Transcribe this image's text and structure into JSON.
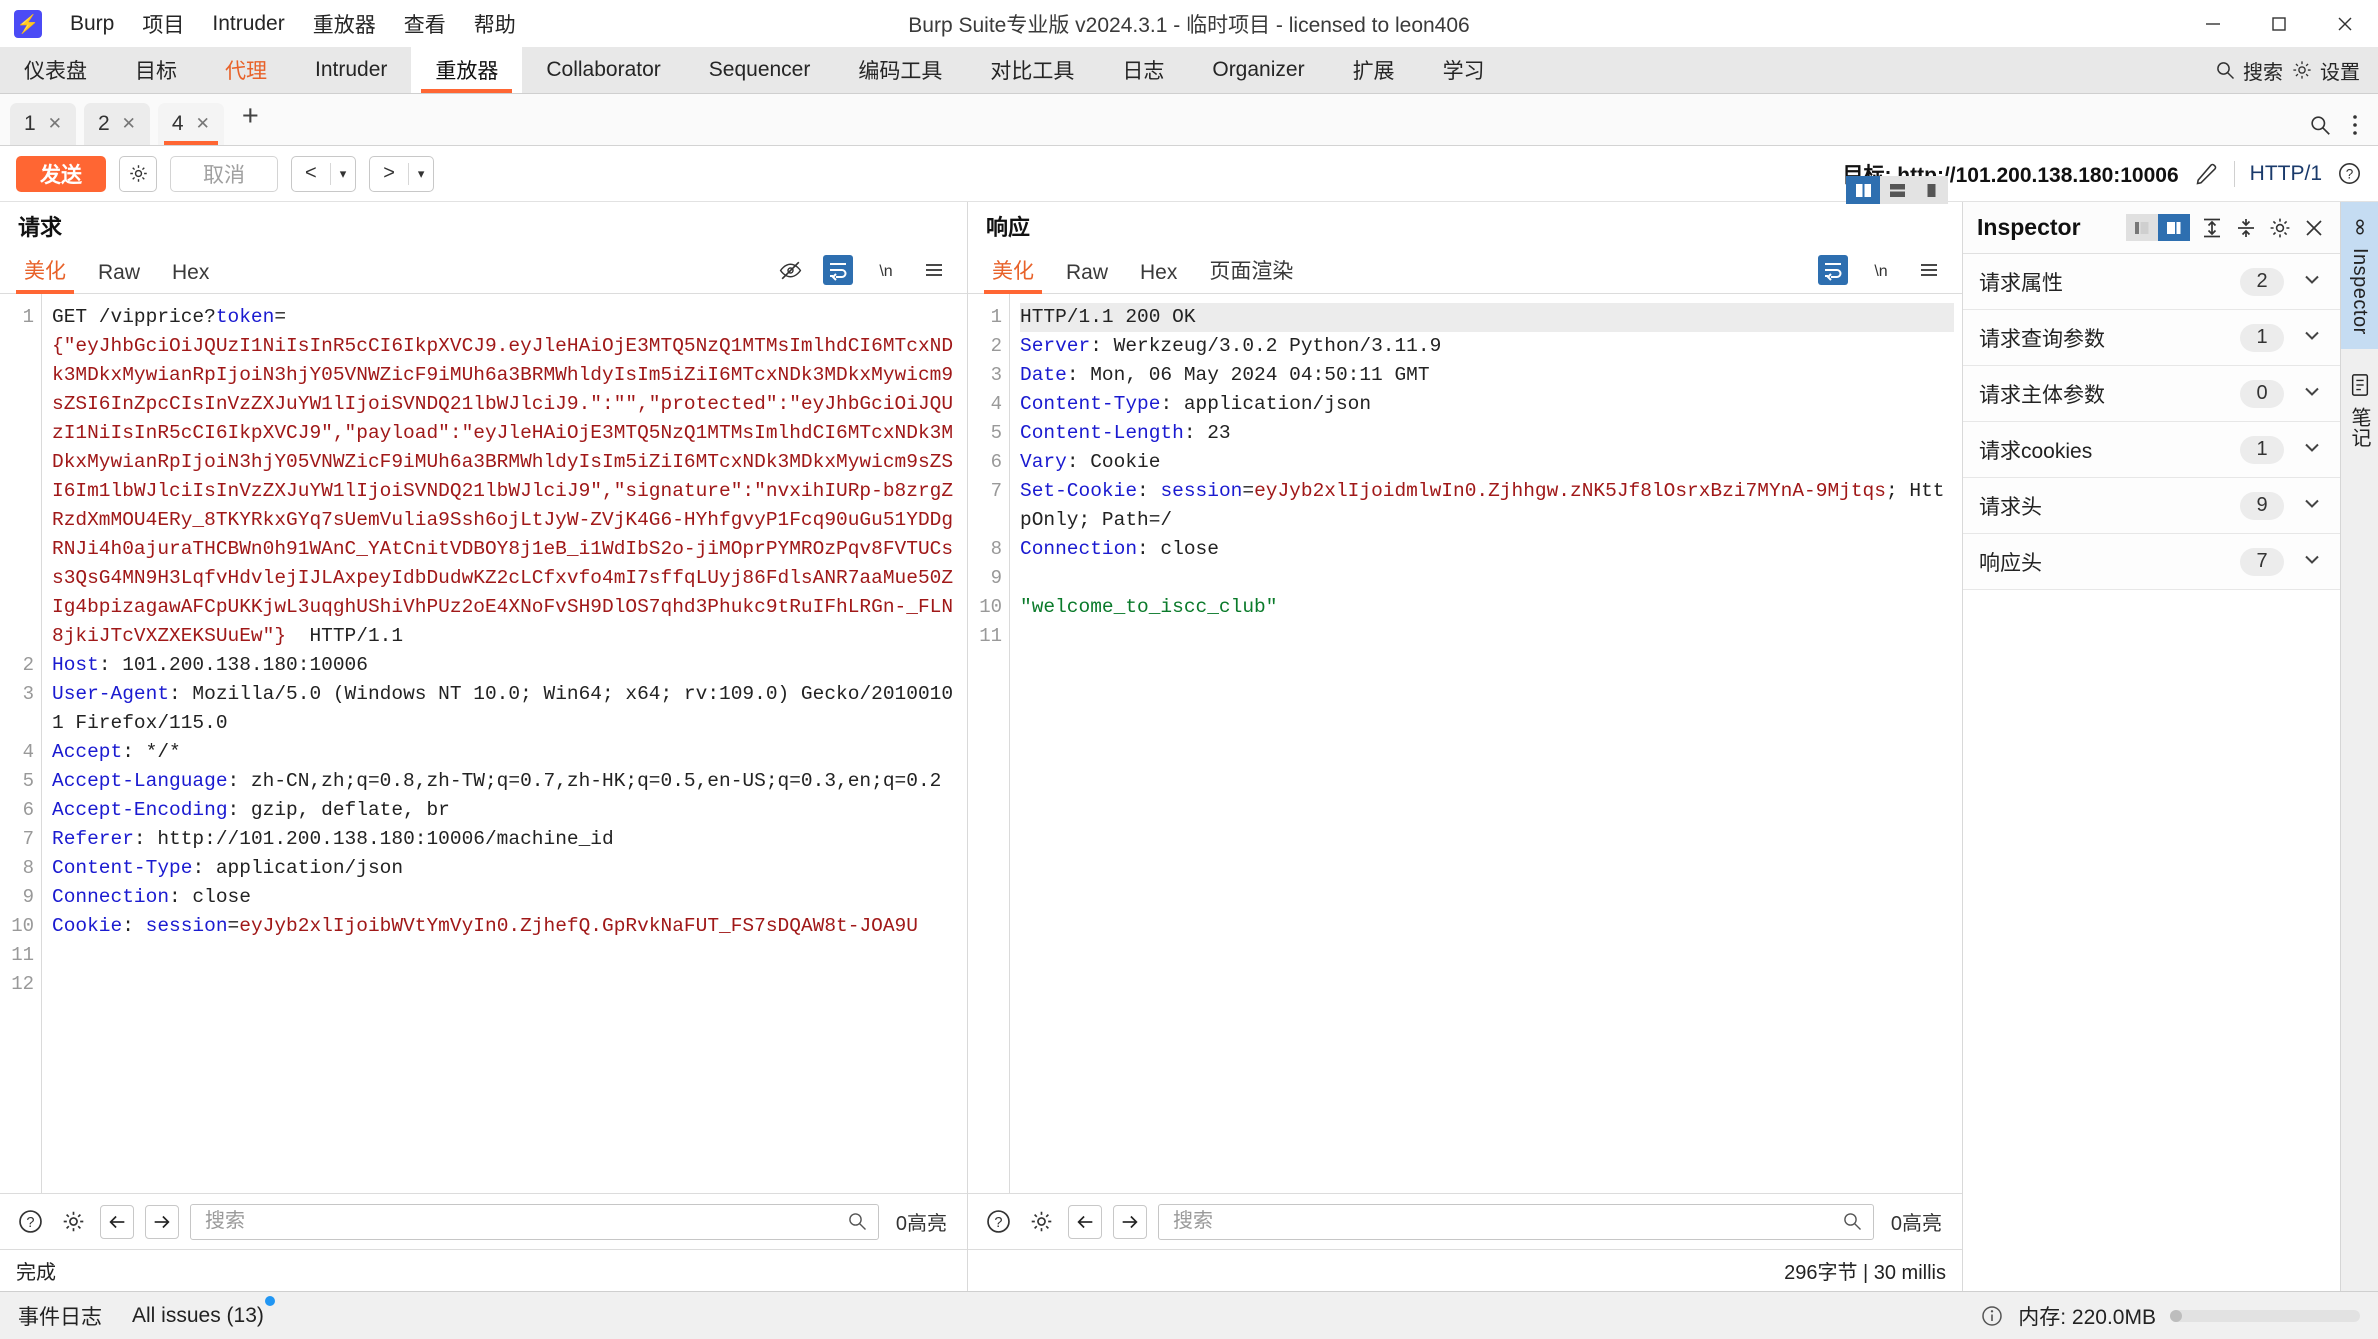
{
  "window": {
    "title": "Burp Suite专业版  v2024.3.1 - 临时项目 - licensed to leon406",
    "minimize": "—",
    "maximize": "☐",
    "close": "✕"
  },
  "menu": [
    "Burp",
    "项目",
    "Intruder",
    "重放器",
    "查看",
    "帮助"
  ],
  "main_tabs": [
    {
      "label": "仪表盘",
      "state": "normal"
    },
    {
      "label": "目标",
      "state": "normal"
    },
    {
      "label": "代理",
      "state": "proxy"
    },
    {
      "label": "Intruder",
      "state": "normal"
    },
    {
      "label": "重放器",
      "state": "active"
    },
    {
      "label": "Collaborator",
      "state": "normal"
    },
    {
      "label": "Sequencer",
      "state": "normal"
    },
    {
      "label": "编码工具",
      "state": "normal"
    },
    {
      "label": "对比工具",
      "state": "normal"
    },
    {
      "label": "日志",
      "state": "normal"
    },
    {
      "label": "Organizer",
      "state": "normal"
    },
    {
      "label": "扩展",
      "state": "normal"
    },
    {
      "label": "学习",
      "state": "normal"
    }
  ],
  "main_tabs_right": {
    "search": "搜索",
    "settings": "设置"
  },
  "repeater_tabs": [
    {
      "label": "1",
      "close": "✕",
      "active": false
    },
    {
      "label": "2",
      "close": "✕",
      "active": false
    },
    {
      "label": "4",
      "close": "✕",
      "active": true
    }
  ],
  "repeater_add": "+",
  "action_bar": {
    "send": "发送",
    "cancel": "取消",
    "back": "<",
    "forward": ">",
    "caret": "▾",
    "target_label": "目标: http://101.200.138.180:10006",
    "http_version": "HTTP/1"
  },
  "request_panel": {
    "title": "请求",
    "tabs": [
      "美化",
      "Raw",
      "Hex"
    ],
    "active_tab": "美化",
    "line_numbers": [
      "1",
      "2",
      "3",
      "4",
      "5",
      "6",
      "7",
      "8",
      "9",
      "10",
      "11",
      "12"
    ],
    "lines": [
      {
        "n": "1",
        "segments": [
          {
            "t": "GET /vipprice?",
            "c": "plain"
          },
          {
            "t": "token",
            "c": "hdr-name"
          },
          {
            "t": "=",
            "c": "plain"
          }
        ]
      },
      {
        "n": "",
        "segments": [
          {
            "t": "{\"eyJhbGciOiJQUzI1NiIsInR5cCI6IkpXVCJ9.eyJleHAiOjE3MTQ5NzQ1MTMsImlhdCI6MTcxNDk3MDkxMywianRpIjoiN3hjY05VNWZicF9iMUh6a3BRMWhldyIsIm5iZiI6MTcxNDk3MDkxMywicm9sZSI6InZpcCIsInVzZXJuYW1lIjoiSVNDQ21lbWJlciJ9.\":\"\",\"protected\":\"eyJhbGciOiJQUzI1NiIsInR5cCI6IkpXVCJ9\",\"payload\":\"eyJleHAiOjE3MTQ5NzQ1MTMsImlhdCI6MTcxNDk3MDkxMywianRpIjoiN3hjY05VNWZicF9iMUh6a3BRMWhldyIsIm5iZiI6MTcxNDk3MDkxMywicm9sZSI6Im1lbWJlciIsInVzZXJuYW1lIjoiSVNDQ21lbWJlciJ9\",\"signature\":\"nvxihIURp-b8zrgZRzdXmMOU4ERy_8TKYRkxGYq7sUemVulia9Ssh6ojLtJyW-ZVjK4G6-HYhfgvyP1Fcq90uGu51YDDgRNJi4h0ajuraTHCBWn0h91WAnC_YAtCnitVDBOY8j1eB_i1WdIbS2o-jiMOprPYMROzPqv8FVTUCss3QsG4MN9H3LqfvHdvlejIJLAxpeyIdbDudwKZ2cLCfxvfo4mI7sffqLUyj86FdlsANR7aaMue50ZIg4bpizagawAFCpUKKjwL3uqghUShiVhPUz2oE4XNoFvSH9DlOS7qhd3Phukc9tRuIFhLRGn-_FLN8jkiJTcVXZXEKSUuEw\"}",
            "c": "val-red"
          },
          {
            "t": "  HTTP/1.1",
            "c": "plain"
          }
        ]
      },
      {
        "n": "2",
        "segments": [
          {
            "t": "Host",
            "c": "hdr-name"
          },
          {
            "t": ": 101.200.138.180:10006",
            "c": "plain"
          }
        ]
      },
      {
        "n": "3",
        "segments": [
          {
            "t": "User-Agent",
            "c": "hdr-name"
          },
          {
            "t": ": Mozilla/5.0 (Windows NT 10.0; Win64; x64; rv:109.0) Gecko/20100101 Firefox/115.0",
            "c": "plain"
          }
        ]
      },
      {
        "n": "4",
        "segments": [
          {
            "t": "Accept",
            "c": "hdr-name"
          },
          {
            "t": ": */*",
            "c": "plain"
          }
        ]
      },
      {
        "n": "5",
        "segments": [
          {
            "t": "Accept-Language",
            "c": "hdr-name"
          },
          {
            "t": ": zh-CN,zh;q=0.8,zh-TW;q=0.7,zh-HK;q=0.5,en-US;q=0.3,en;q=0.2",
            "c": "plain"
          }
        ]
      },
      {
        "n": "6",
        "segments": [
          {
            "t": "Accept-Encoding",
            "c": "hdr-name"
          },
          {
            "t": ": gzip, deflate, br",
            "c": "plain"
          }
        ]
      },
      {
        "n": "7",
        "segments": [
          {
            "t": "Referer",
            "c": "hdr-name"
          },
          {
            "t": ": http://101.200.138.180:10006/machine_id",
            "c": "plain"
          }
        ]
      },
      {
        "n": "8",
        "segments": [
          {
            "t": "Content-Type",
            "c": "hdr-name"
          },
          {
            "t": ": application/json",
            "c": "plain"
          }
        ]
      },
      {
        "n": "9",
        "segments": [
          {
            "t": "Connection",
            "c": "hdr-name"
          },
          {
            "t": ": close",
            "c": "plain"
          }
        ]
      },
      {
        "n": "10",
        "segments": [
          {
            "t": "Cookie",
            "c": "hdr-name"
          },
          {
            "t": ": ",
            "c": "plain"
          },
          {
            "t": "session",
            "c": "hdr-name"
          },
          {
            "t": "=",
            "c": "plain"
          },
          {
            "t": "eyJyb2xlIjoibWVtYmVyIn0.ZjhefQ.GpRvkNaFUT_FS7sDQAW8t-JOA9U",
            "c": "val-red"
          }
        ]
      },
      {
        "n": "11",
        "segments": [
          {
            "t": "",
            "c": "plain"
          }
        ]
      },
      {
        "n": "12",
        "segments": [
          {
            "t": "",
            "c": "plain"
          }
        ]
      }
    ],
    "find": {
      "placeholder": "搜索",
      "highlight_count": "0高亮",
      "help": "?",
      "settings": "gear",
      "prev": "←",
      "next": "→"
    }
  },
  "response_panel": {
    "title": "响应",
    "tabs": [
      "美化",
      "Raw",
      "Hex",
      "页面渲染"
    ],
    "active_tab": "美化",
    "lines": [
      {
        "n": "1",
        "hl": true,
        "segments": [
          {
            "t": "HTTP/1.1 200 OK",
            "c": "plain"
          }
        ]
      },
      {
        "n": "2",
        "segments": [
          {
            "t": "Server",
            "c": "hdr-name"
          },
          {
            "t": ": Werkzeug/3.0.2 Python/3.11.9",
            "c": "plain"
          }
        ]
      },
      {
        "n": "3",
        "segments": [
          {
            "t": "Date",
            "c": "hdr-name"
          },
          {
            "t": ": Mon, 06 May 2024 04:50:11 GMT",
            "c": "plain"
          }
        ]
      },
      {
        "n": "4",
        "segments": [
          {
            "t": "Content-Type",
            "c": "hdr-name"
          },
          {
            "t": ": application/json",
            "c": "plain"
          }
        ]
      },
      {
        "n": "5",
        "segments": [
          {
            "t": "Content-Length",
            "c": "hdr-name"
          },
          {
            "t": ": 23",
            "c": "plain"
          }
        ]
      },
      {
        "n": "6",
        "segments": [
          {
            "t": "Vary",
            "c": "hdr-name"
          },
          {
            "t": ": Cookie",
            "c": "plain"
          }
        ]
      },
      {
        "n": "7",
        "segments": [
          {
            "t": "Set-Cookie",
            "c": "hdr-name"
          },
          {
            "t": ": ",
            "c": "plain"
          },
          {
            "t": "session",
            "c": "hdr-name"
          },
          {
            "t": "=",
            "c": "plain"
          },
          {
            "t": "eyJyb2xlIjoidmlwIn0.Zjhhgw.zNK5Jf8lOsrxBzi7MYnA-9Mjtqs",
            "c": "val-red"
          },
          {
            "t": "; HttpOnly; Path=/",
            "c": "plain"
          }
        ]
      },
      {
        "n": "8",
        "segments": [
          {
            "t": "Connection",
            "c": "hdr-name"
          },
          {
            "t": ": close",
            "c": "plain"
          }
        ]
      },
      {
        "n": "9",
        "segments": [
          {
            "t": "",
            "c": "plain"
          }
        ]
      },
      {
        "n": "10",
        "segments": [
          {
            "t": "\"welcome_to_iscc_club\"",
            "c": "val-green"
          }
        ]
      },
      {
        "n": "11",
        "segments": [
          {
            "t": "",
            "c": "plain"
          }
        ]
      }
    ],
    "find": {
      "placeholder": "搜索",
      "highlight_count": "0高亮"
    }
  },
  "inspector": {
    "title": "Inspector",
    "rows": [
      {
        "label": "请求属性",
        "count": "2"
      },
      {
        "label": "请求查询参数",
        "count": "1"
      },
      {
        "label": "请求主体参数",
        "count": "0"
      },
      {
        "label": "请求cookies",
        "count": "1"
      },
      {
        "label": "请求头",
        "count": "9"
      },
      {
        "label": "响应头",
        "count": "7"
      }
    ],
    "chevron": "⌄"
  },
  "rail": {
    "inspector_label": "Inspector",
    "notes_label": "笔记"
  },
  "status": {
    "request_status": "完成",
    "response_meta": "296字节 | 30 millis"
  },
  "bottom_bar": {
    "event_log": "事件日志",
    "all_issues": "All issues (13)",
    "memory": "内存: 220.0MB"
  },
  "colors": {
    "accent": "#ff6633",
    "link_blue": "#1a1ad0",
    "value_red": "#a01818",
    "value_green": "#0a7a2a",
    "selected_blue": "#2e6fb0"
  }
}
